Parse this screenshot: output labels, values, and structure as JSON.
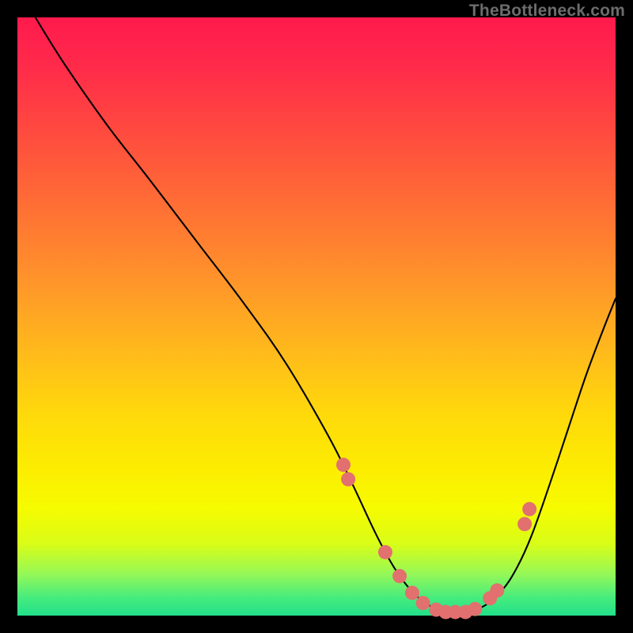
{
  "watermark": "TheBottleneck.com",
  "chart_data": {
    "type": "line",
    "title": "",
    "xlabel": "",
    "ylabel": "",
    "xlim": [
      0,
      100
    ],
    "ylim": [
      0,
      100
    ],
    "curve": {
      "name": "bottleneck-curve",
      "x": [
        3,
        8,
        15,
        22,
        30,
        38,
        45,
        52,
        56,
        60,
        63,
        66,
        69,
        72,
        75,
        78,
        81,
        83.5,
        86,
        89,
        92,
        95,
        98,
        100
      ],
      "y": [
        100,
        92,
        82,
        73,
        62.5,
        52,
        42,
        30,
        22,
        13.5,
        8,
        4,
        1.6,
        0.6,
        0.6,
        1.6,
        4.2,
        8,
        13.5,
        22,
        31,
        40,
        48,
        53
      ]
    },
    "scatter": {
      "name": "measured-points",
      "color": "#e2706e",
      "x": [
        54.5,
        55.3,
        61.5,
        63.9,
        66.0,
        67.8,
        70.0,
        71.6,
        73.2,
        74.9,
        76.5,
        79.0,
        80.2,
        84.8,
        85.6
      ],
      "y": [
        25.2,
        22.8,
        10.6,
        6.6,
        3.8,
        2.1,
        1.0,
        0.6,
        0.6,
        0.6,
        1.1,
        2.9,
        4.2,
        15.3,
        17.8
      ]
    }
  }
}
